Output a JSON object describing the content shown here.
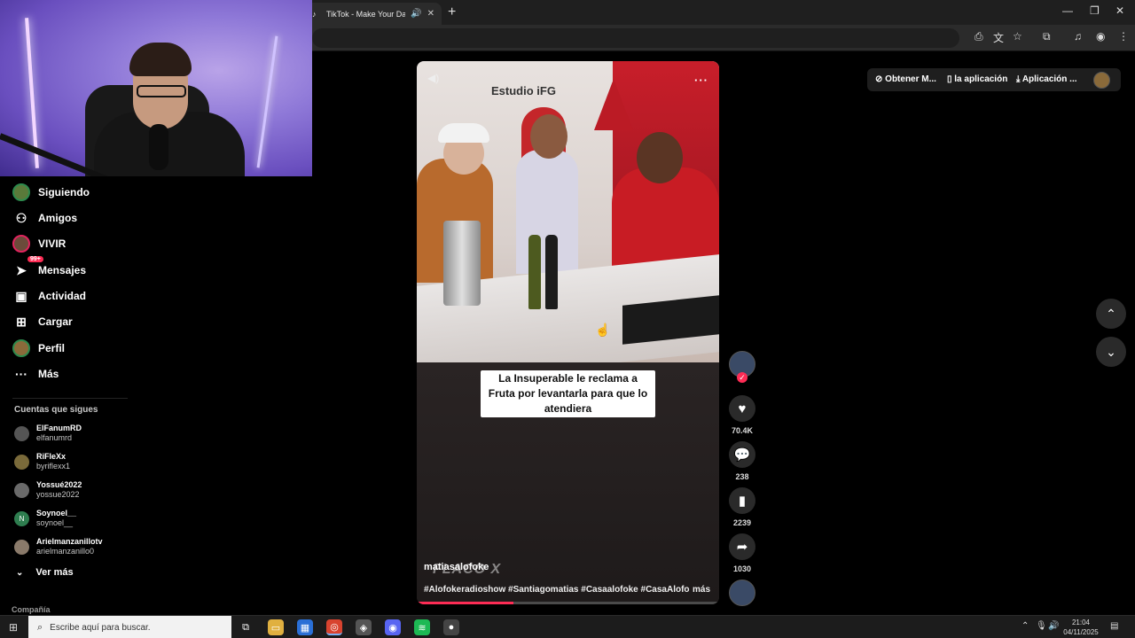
{
  "browser": {
    "tab_title": "TikTok - Make Your Day",
    "new_tab": "+",
    "window_controls": {
      "minimize": "—",
      "restore": "❐",
      "close": "✕"
    }
  },
  "sidebar": {
    "items": [
      {
        "label": "Siguiendo",
        "icon": "following-avatar"
      },
      {
        "label": "Amigos",
        "icon": "friends-icon"
      },
      {
        "label": "VIVIR",
        "icon": "live-avatar"
      },
      {
        "label": "Mensajes",
        "icon": "messages-icon",
        "badge": "99+"
      },
      {
        "label": "Actividad",
        "icon": "activity-icon"
      },
      {
        "label": "Cargar",
        "icon": "upload-icon"
      },
      {
        "label": "Perfil",
        "icon": "profile-avatar"
      },
      {
        "label": "Más",
        "icon": "more-dots-icon"
      }
    ],
    "following_title": "Cuentas que sigues",
    "following": [
      {
        "display": "ElFanumRD",
        "user": "elfanumrd"
      },
      {
        "display": "RiFleXx",
        "user": "byriflexx1"
      },
      {
        "display": "Yossué2022",
        "user": "yossue2022"
      },
      {
        "display": "Soynoel__",
        "user": "soynoel__",
        "initial": "N"
      },
      {
        "display": "Arielmanzanillotv",
        "user": "arielmanzanillo0"
      }
    ],
    "see_more": "Ver más",
    "company": "Compañía"
  },
  "video": {
    "studio_sign": "Estudio iFG",
    "caption": "La Insuperable le reclama a Fruta por levantarla para que lo atendiera",
    "username": "matiasalofoke",
    "brand_watermark": "FLACO X",
    "hashtags": "#Alofokeradioshow #Santiagomatias #Casaalofoke #CasaAlofok...",
    "more": "más",
    "progress": 0.32
  },
  "actions": {
    "likes": "70.4K",
    "comments": "238",
    "saves": "2239",
    "shares": "1030"
  },
  "top_actions": {
    "get_app": "Obtener M...",
    "the_app": "la aplicación",
    "app": "Aplicación ..."
  },
  "taskbar": {
    "search_placeholder": "Escribe aquí para buscar.",
    "time": "21:04",
    "date": "04/11/2025"
  },
  "colors": {
    "accent": "#fe2c55",
    "background": "#000000"
  }
}
